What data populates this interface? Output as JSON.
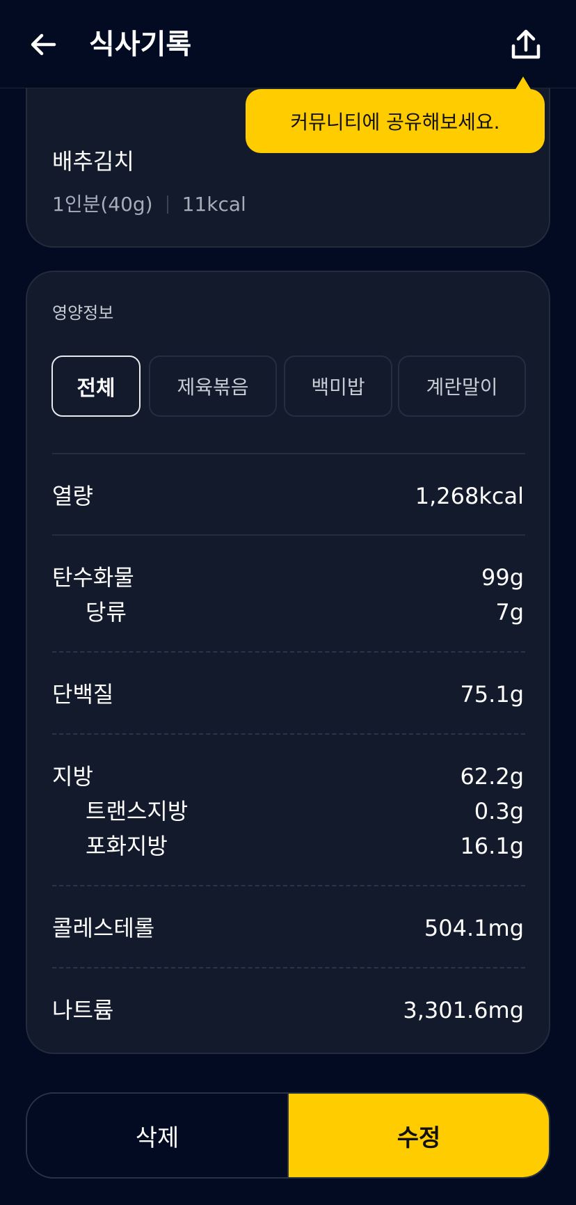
{
  "header": {
    "title": "식사기록",
    "back_icon": "arrow-left-icon",
    "share_icon": "share-upload-icon"
  },
  "tooltip": {
    "text": "커뮤니티에 공유해보세요."
  },
  "food": {
    "name": "배추김치",
    "serving": "1인분(40g)",
    "calories": "11kcal"
  },
  "nutrition": {
    "title": "영양정보",
    "tabs": [
      {
        "label": "전체",
        "active": true
      },
      {
        "label": "제육볶음",
        "active": false
      },
      {
        "label": "백미밥",
        "active": false
      },
      {
        "label": "계란말이",
        "active": false
      }
    ],
    "rows": [
      {
        "label": "열량",
        "value": "1,268kcal"
      },
      {
        "label": "탄수화물",
        "value": "99g"
      },
      {
        "label": "당류",
        "value": "7g"
      },
      {
        "label": "단백질",
        "value": "75.1g"
      },
      {
        "label": "지방",
        "value": "62.2g"
      },
      {
        "label": "트랜스지방",
        "value": "0.3g"
      },
      {
        "label": "포화지방",
        "value": "16.1g"
      },
      {
        "label": "콜레스테롤",
        "value": "504.1mg"
      },
      {
        "label": "나트륨",
        "value": "3,301.6mg"
      }
    ]
  },
  "actions": {
    "delete_label": "삭제",
    "edit_label": "수정"
  },
  "colors": {
    "background": "#020b22",
    "card": "#121a2b",
    "accent": "#ffcc00"
  }
}
